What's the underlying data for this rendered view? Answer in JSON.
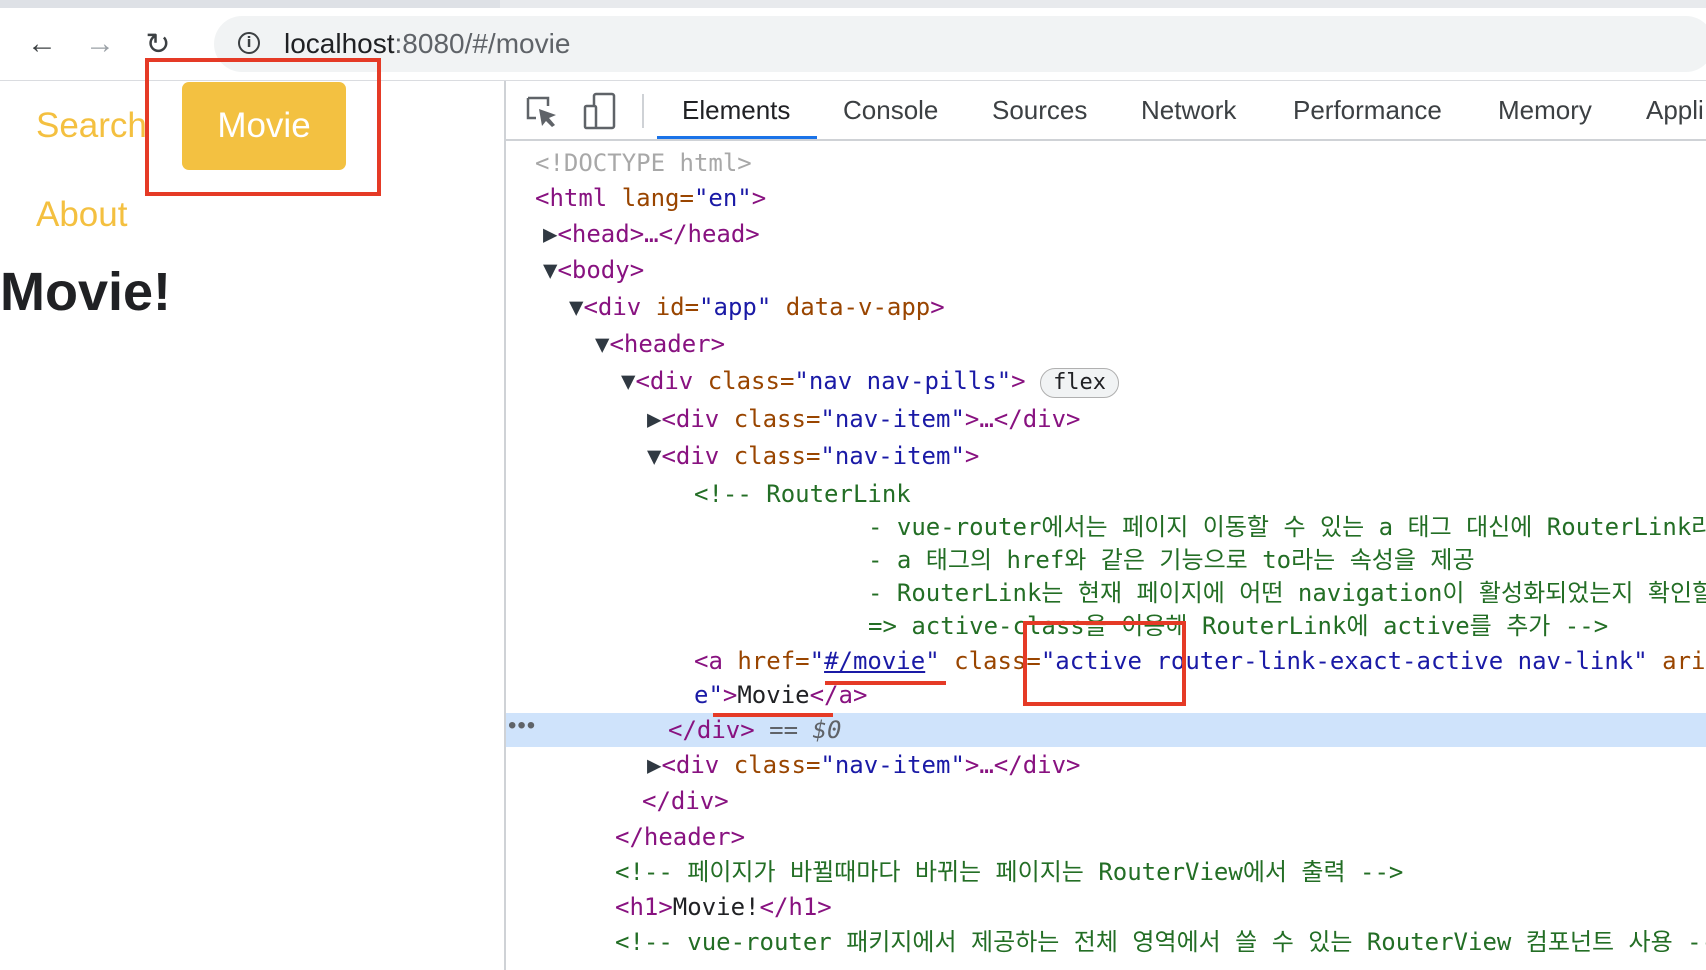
{
  "browser": {
    "url_host": "localhost",
    "url_rest": ":8080/#/movie",
    "back_icon": "←",
    "forward_icon": "→",
    "reload_icon": "↻",
    "info_icon": "i"
  },
  "page": {
    "nav": {
      "search": "Search",
      "movie": "Movie",
      "about": "About"
    },
    "heading": "Movie!"
  },
  "devtools": {
    "tabs": [
      "Elements",
      "Console",
      "Sources",
      "Network",
      "Performance",
      "Memory",
      "Appli"
    ],
    "active_tab": "Elements",
    "selected_suffix": "== $0",
    "flex_badge": "flex",
    "dots": "•••",
    "lines": {
      "doctype": "<!DOCTYPE html>",
      "html_open": "<html",
      "html_attr": " lang=",
      "html_val": "\"en\"",
      "html_close": ">",
      "head": "<head>…</head>",
      "body": "<body>",
      "div_app_open": "<div",
      "div_app_id": " id=",
      "div_app_idval": "\"app\"",
      "div_app_attr": " data-v-app",
      "div_app_close": ">",
      "header": "<header>",
      "nav_open": "<div",
      "nav_class": " class=",
      "nav_val": "\"nav nav-pills\"",
      "nav_close": ">",
      "item_open": "<div",
      "item_class": " class=",
      "item_val": "\"nav-item\"",
      "item_collapsed_close": ">…</div>",
      "item_close": ">",
      "c1": "<!-- RouterLink",
      "c2": "- vue-router에서는 페이지 이동할 수 있는 a 태그 대신에 RouterLink라는",
      "c3": "- a 태그의 href와 같은 기능으로 to라는 속성을 제공",
      "c4": "- RouterLink는 현재 페이지에 어떤 navigation이 활성화되었는지 확인할",
      "c5": "=> active-class을 이용해 RouterLink에 active를 추가 -->",
      "a_open": "<a",
      "a_href": " href=",
      "a_q1": "\"",
      "a_link": "#/movie",
      "a_q2": "\"",
      "a_class": " class=",
      "a_classval": "\"active router-link-exact-active nav-link\"",
      "a_ari": " ari",
      "a_cont_val": "e\"",
      "a_gt": ">",
      "a_text": "Movie",
      "a_close": "</a>",
      "div_close": "</div>",
      "header_close": "</header>",
      "c6": "<!-- 페이지가 바뀔때마다 바뀌는 페이지는 RouterView에서 출력 -->",
      "h1_open": "<h1>",
      "h1_text": "Movie!",
      "h1_close": "</h1>",
      "c7": "<!-- vue-router 패키지에서 제공하는 전체 영역에서 쓸 수 있는 RouterView 컴포넌트 사용 -->"
    }
  }
}
